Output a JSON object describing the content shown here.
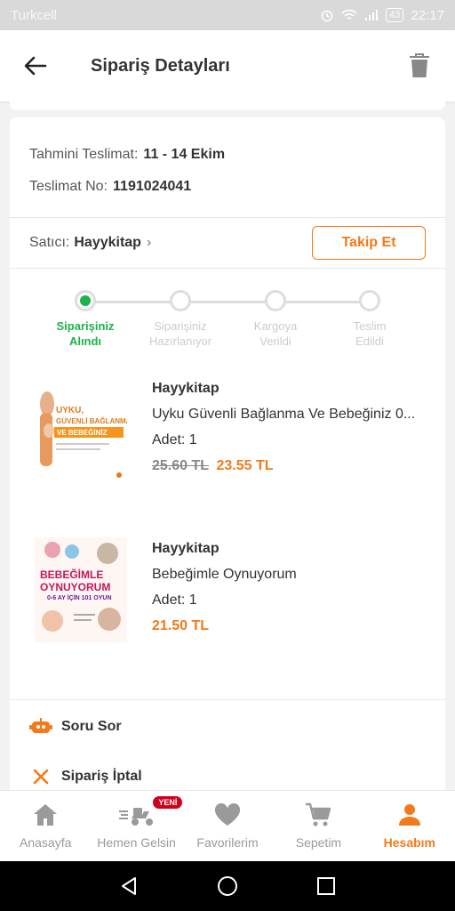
{
  "status_bar": {
    "carrier": "Turkcell",
    "battery": "43",
    "time": "22:17"
  },
  "header": {
    "title": "Sipariş Detayları"
  },
  "delivery": {
    "estimate_label": "Tahmini Teslimat:",
    "estimate_value": "11 - 14 Ekim",
    "number_label": "Teslimat No:",
    "number_value": "1191024041"
  },
  "seller": {
    "label": "Satıcı:",
    "name": "Hayykitap",
    "follow_label": "Takip Et"
  },
  "tracker": {
    "steps": [
      {
        "line1": "Siparişiniz",
        "line2": "Alındı"
      },
      {
        "line1": "Siparişiniz",
        "line2": "Hazırlanıyor"
      },
      {
        "line1": "Kargoya",
        "line2": "Verildi"
      },
      {
        "line1": "Teslim",
        "line2": "Edildi"
      }
    ],
    "active_index": 0
  },
  "products": [
    {
      "seller": "Hayykitap",
      "name": "Uyku Güvenli Bağlanma Ve Bebeğiniz 0...",
      "qty": "Adet: 1",
      "old_price": "25.60 TL",
      "price": "23.55 TL",
      "cover_text": [
        "UYKU,",
        "GÜVENLİ BAĞLANMA",
        "VE BEBEĞİNİZ"
      ]
    },
    {
      "seller": "Hayykitap",
      "name": "Bebeğimle Oynuyorum",
      "qty": "Adet: 1",
      "old_price": "",
      "price": "21.50 TL",
      "cover_text": [
        "BEBEĞİMLE",
        "OYNUYORUM",
        "0-6 AY İÇİN 101 OYUN"
      ]
    }
  ],
  "actions": {
    "ask": "Soru Sor",
    "cancel": "Sipariş İptal"
  },
  "bottom_nav": {
    "items": [
      {
        "label": "Anasayfa",
        "icon": "home-icon"
      },
      {
        "label": "Hemen Gelsin",
        "icon": "scooter-icon",
        "badge": "YENİ"
      },
      {
        "label": "Favorilerim",
        "icon": "heart-icon"
      },
      {
        "label": "Sepetim",
        "icon": "cart-icon"
      },
      {
        "label": "Hesabım",
        "icon": "person-icon"
      }
    ],
    "active": "Hesabım"
  },
  "colors": {
    "accent": "#f27a1a",
    "success": "#1bb34a",
    "badge": "#d0021b"
  }
}
